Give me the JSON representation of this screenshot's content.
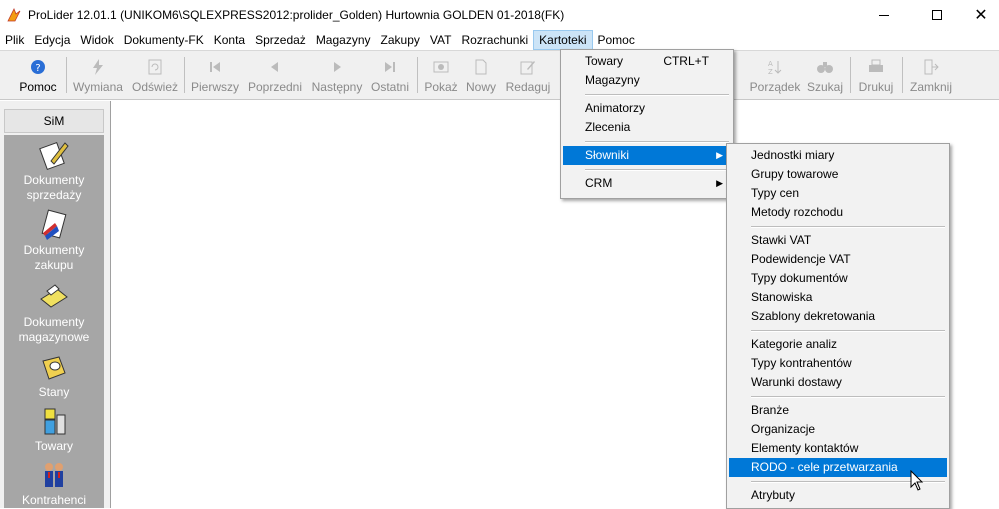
{
  "window": {
    "title": "ProLider 12.01.1  (UNIKOM6\\SQLEXPRESS2012:prolider_Golden) Hurtownia GOLDEN 01-2018(FK)",
    "close_glyph": "✕"
  },
  "menubar": [
    "Plik",
    "Edycja",
    "Widok",
    "Dokumenty-FK",
    "Konta",
    "Sprzedaż",
    "Magazyny",
    "Zakupy",
    "VAT",
    "Rozrachunki",
    "Kartoteki",
    "Pomoc"
  ],
  "toolbar": {
    "pomoc": "Pomoc",
    "wymiana": "Wymiana",
    "odswiez": "Odśwież",
    "pierwszy": "Pierwszy",
    "poprzedni": "Poprzedni",
    "nastepny": "Następny",
    "ostatni": "Ostatni",
    "pokaz": "Pokaż",
    "nowy": "Nowy",
    "redaguj": "Redaguj",
    "porzadek": "Porządek",
    "szukaj": "Szukaj",
    "drukuj": "Drukuj",
    "zamknij": "Zamknij"
  },
  "sidebar": {
    "header": "SiM",
    "items": [
      {
        "line1": "Dokumenty",
        "line2": "sprzedaży",
        "icon": "pen-document-icon"
      },
      {
        "line1": "Dokumenty",
        "line2": "zakupu",
        "icon": "document-stamp-icon"
      },
      {
        "line1": "Dokumenty",
        "line2": "magazynowe",
        "icon": "warehouse-document-icon"
      },
      {
        "line1": "Stany",
        "line2": "",
        "icon": "stock-folder-icon"
      },
      {
        "line1": "Towary",
        "line2": "",
        "icon": "goods-icon"
      },
      {
        "line1": "Kontrahenci",
        "line2": "",
        "icon": "contractors-icon"
      }
    ]
  },
  "kartoteki_menu": {
    "towary": "Towary",
    "towary_shortcut": "CTRL+T",
    "magazyny": "Magazyny",
    "animatorzy": "Animatorzy",
    "zlecenia": "Zlecenia",
    "slowniki": "Słowniki",
    "crm": "CRM"
  },
  "slowniki_menu": {
    "group1": [
      "Jednostki miary",
      "Grupy towarowe",
      "Typy cen",
      "Metody rozchodu"
    ],
    "group2": [
      "Stawki VAT",
      "Podewidencje VAT",
      "Typy dokumentów",
      "Stanowiska",
      "Szablony dekretowania"
    ],
    "group3": [
      "Kategorie analiz",
      "Typy kontrahentów",
      "Warunki dostawy"
    ],
    "group4": [
      "Branże",
      "Organizacje",
      "Elementy kontaktów",
      "RODO - cele przetwarzania"
    ],
    "group5": [
      "Atrybuty"
    ],
    "highlighted": "RODO - cele przetwarzania"
  },
  "colors": {
    "highlight": "#0078d7",
    "sidebar_bg": "#a6a6a6",
    "menu_active": "#cce4f7"
  }
}
